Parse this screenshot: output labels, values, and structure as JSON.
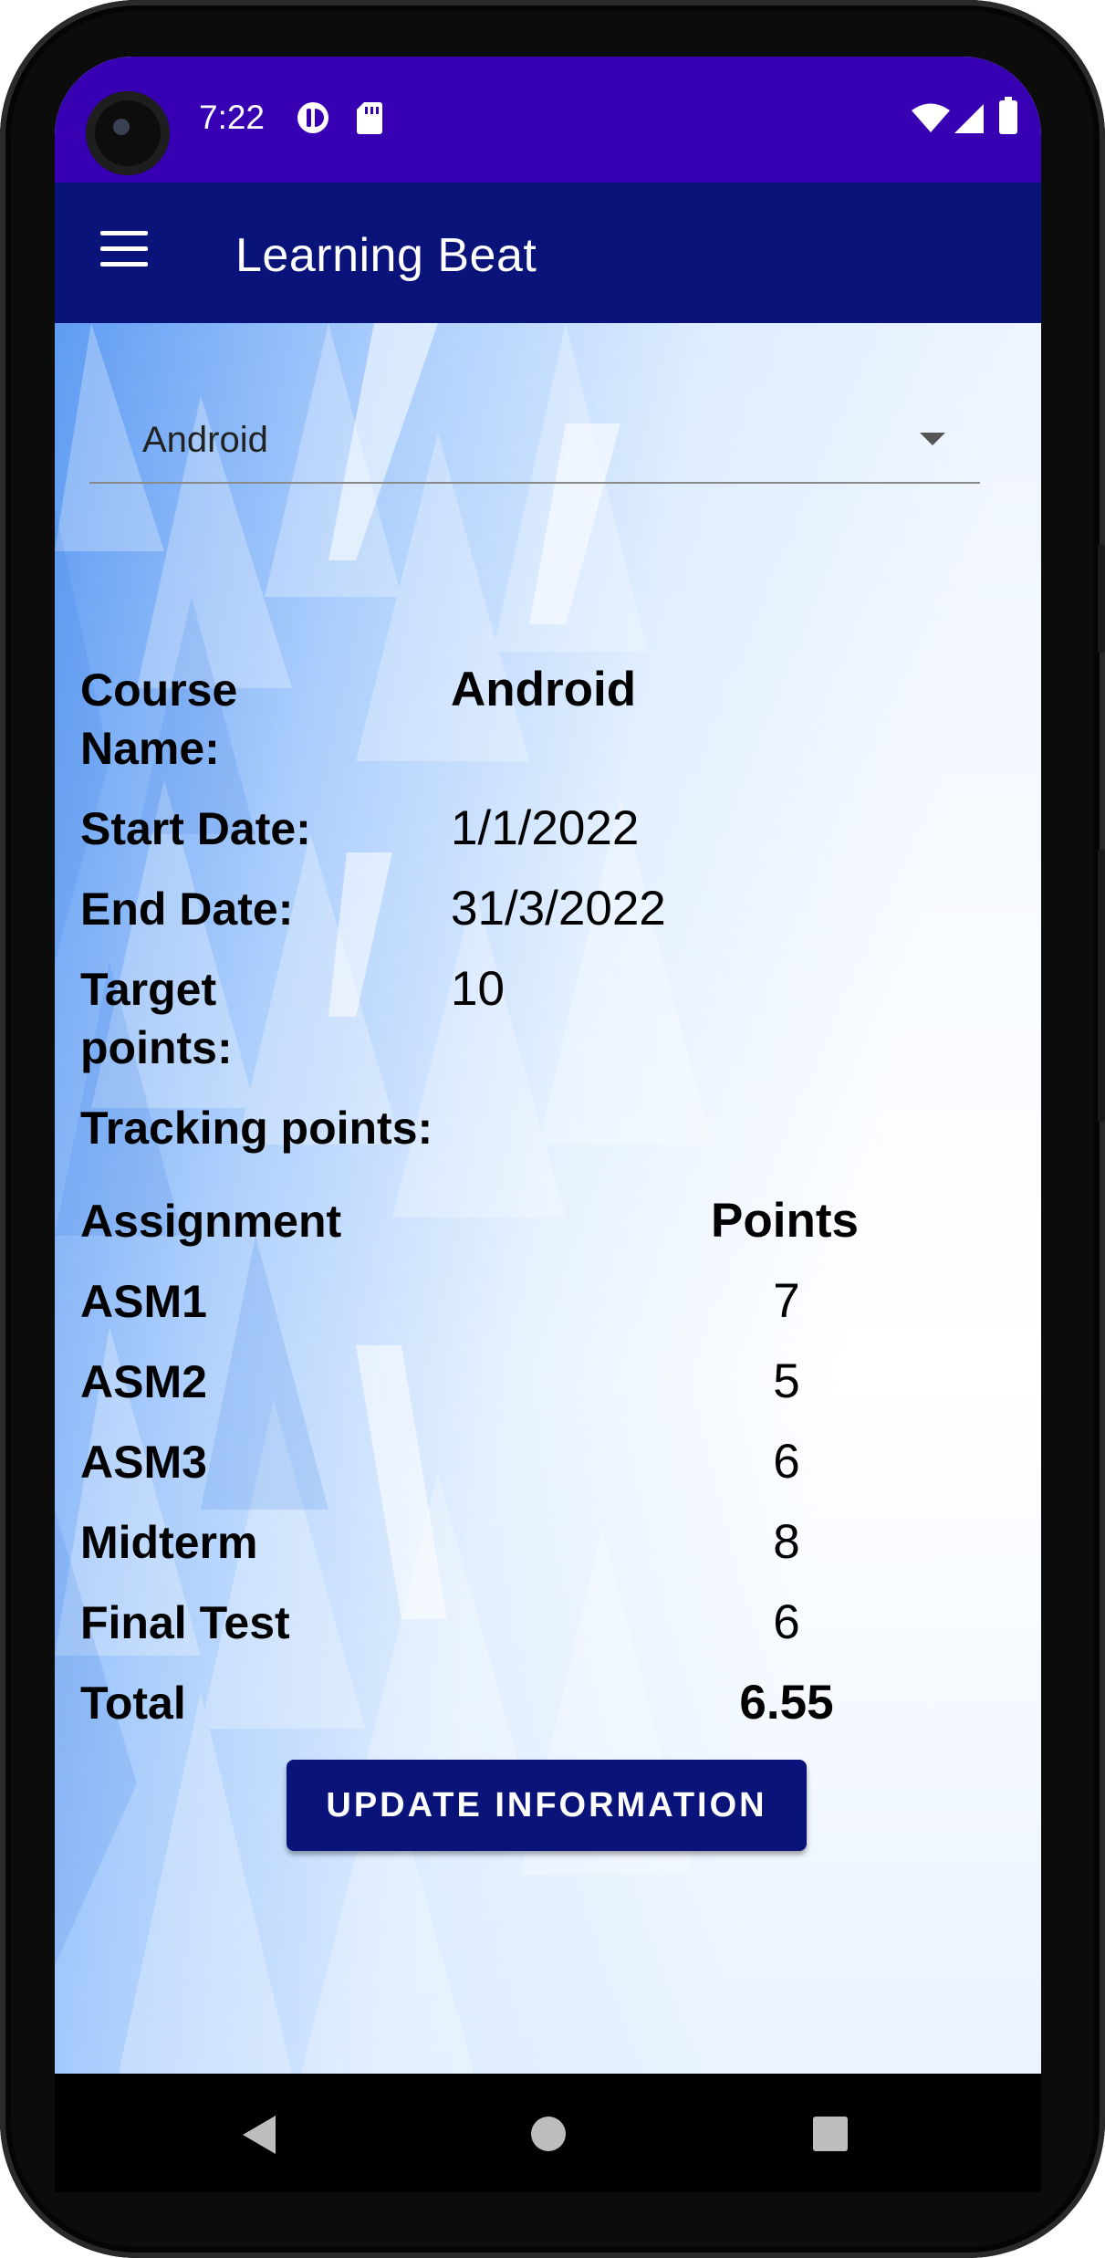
{
  "status_bar": {
    "time": "7:22",
    "left_icons": [
      "notification-app-icon",
      "sd-card-icon"
    ],
    "right_icons": [
      "wifi-icon",
      "cellular-signal-icon",
      "battery-icon"
    ],
    "color": "#3700b3"
  },
  "app_bar": {
    "title": "Learning Beat",
    "menu_icon": "menu-icon",
    "color": "#0a137a"
  },
  "course_selector": {
    "selected": "Android"
  },
  "details": {
    "course_name_label": "Course\nName:",
    "course_name_value": "Android",
    "start_date_label": "Start Date:",
    "start_date_value": "1/1/2022",
    "end_date_label": "End Date:",
    "end_date_value": "31/3/2022",
    "target_points_label": "Target\npoints:",
    "target_points_value": "10",
    "tracking_points_label": "Tracking points:"
  },
  "points_table": {
    "headers": [
      "Assignment",
      "Points"
    ],
    "rows": [
      {
        "name": "ASM1",
        "points": "7"
      },
      {
        "name": "ASM2",
        "points": "5"
      },
      {
        "name": "ASM3",
        "points": "6"
      },
      {
        "name": "Midterm",
        "points": "8"
      },
      {
        "name": "Final Test",
        "points": "6"
      }
    ],
    "total_label": "Total",
    "total_value": "6.55"
  },
  "actions": {
    "update_label": "UPDATE INFORMATION"
  },
  "nav_bar": {
    "buttons": [
      "back-icon",
      "home-icon",
      "recents-icon"
    ]
  }
}
